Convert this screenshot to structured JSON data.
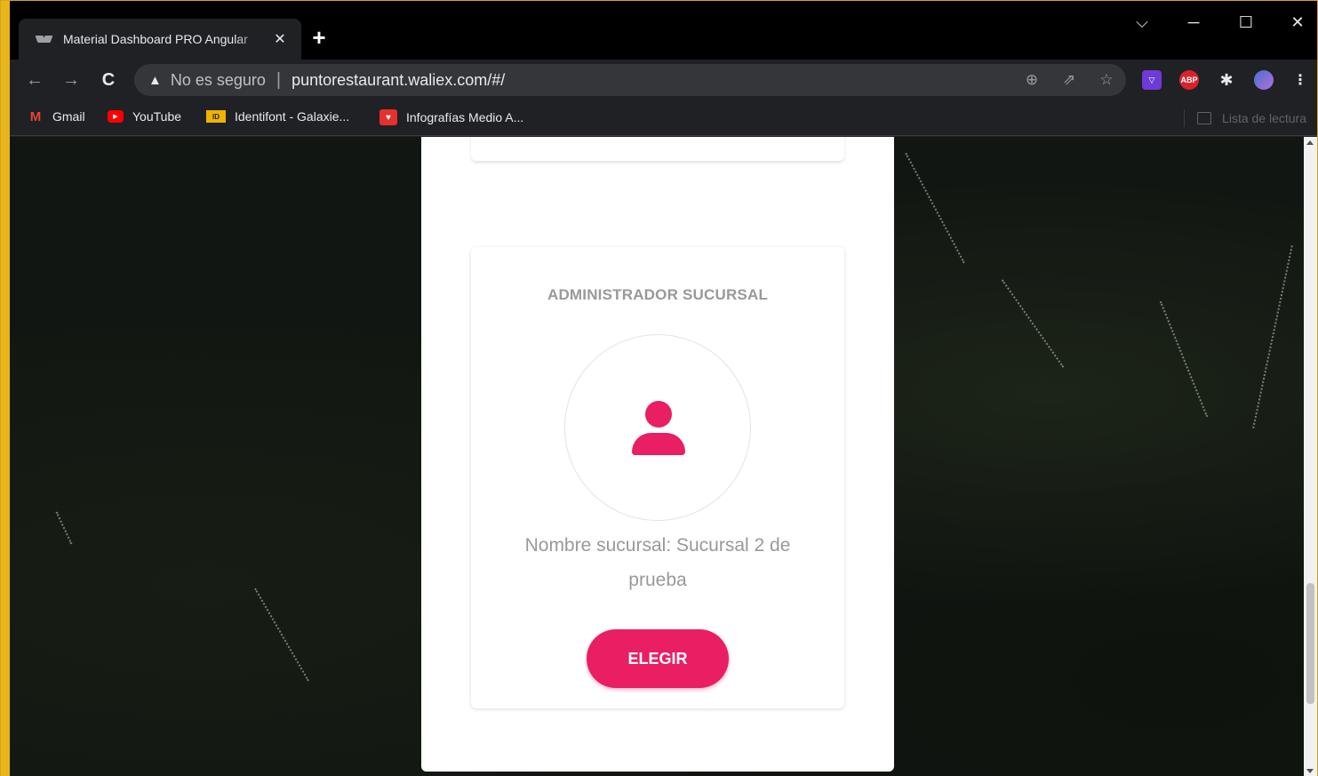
{
  "browser": {
    "tab_title": "Material Dashboard PRO Angular",
    "tab_close": "✕",
    "new_tab": "+",
    "window_controls": {
      "tabsearch": "⌵",
      "minimize": "─",
      "maximize": "☐",
      "close": "✕"
    },
    "nav": {
      "back": "←",
      "forward": "→",
      "reload": "C"
    },
    "address": {
      "security_label": "No es seguro",
      "separator": "|",
      "url": "puntorestaurant.waliex.com/#/"
    },
    "extensions": [
      "ABP"
    ],
    "icons": [
      "warning-icon",
      "zoom-icon",
      "share-icon",
      "star-icon",
      "extension-icon",
      "puzzle-icon",
      "avatar-icon",
      "menu-icon"
    ]
  },
  "bookmarks": [
    {
      "label": "Gmail",
      "icon": "gmail-icon"
    },
    {
      "label": "YouTube",
      "icon": "youtube-icon"
    },
    {
      "label": "Identifont - Galaxie...",
      "icon": "identifont-icon"
    },
    {
      "label": "Infografías Medio A...",
      "icon": "infografias-icon"
    }
  ],
  "reading_list": "Lista de lectura",
  "page": {
    "card": {
      "role": "ADMINISTRADOR SUCURSAL",
      "branch": "Nombre sucursal: Sucursal 2 de prueba",
      "button": "ELEGIR"
    }
  },
  "colors": {
    "accent": "#e91e63",
    "chrome_bg": "#202124",
    "frame": "#e8b51a"
  }
}
